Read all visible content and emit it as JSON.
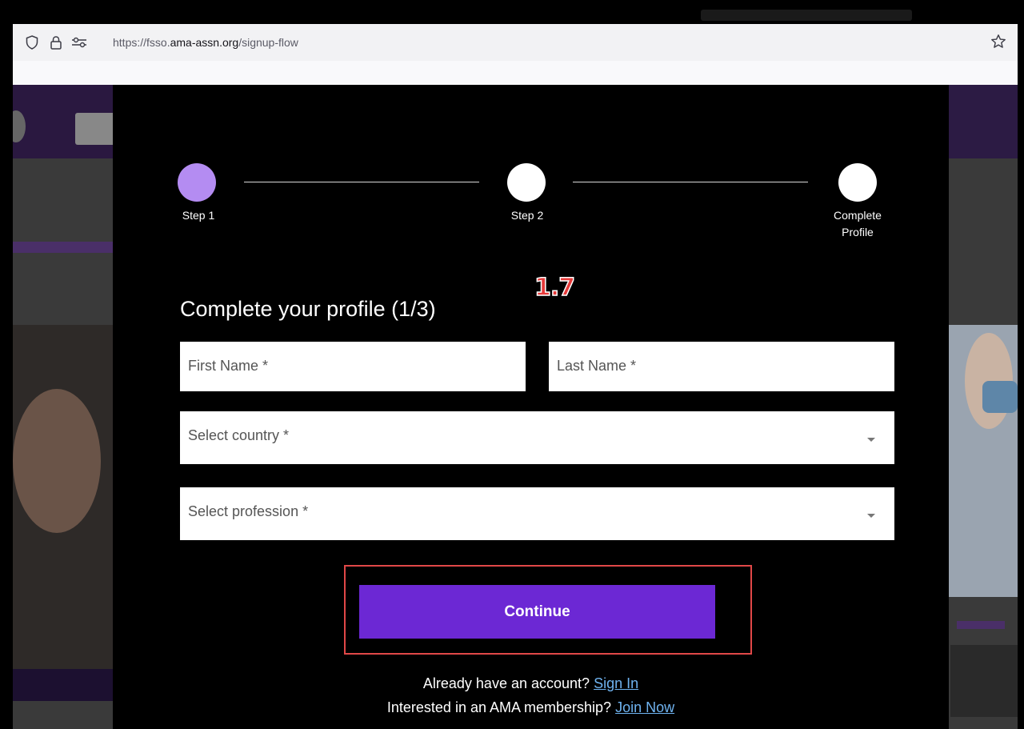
{
  "browser": {
    "url_prefix": "https://fsso.",
    "url_domain": "ama-assn.org",
    "url_path": "/signup-flow",
    "icons": [
      "shield-icon",
      "lock-icon",
      "permissions-icon",
      "bookmark-star-icon"
    ]
  },
  "stepper": {
    "steps": [
      {
        "label": "Step 1",
        "state": "active"
      },
      {
        "label": "Step 2",
        "state": "idle"
      },
      {
        "label_line1": "Complete",
        "label_line2": "Profile",
        "state": "idle"
      }
    ],
    "active_color": "#b48cf2"
  },
  "annotation": "1.7",
  "form": {
    "title": "Complete your profile (1/3)",
    "first_name_placeholder": "First Name *",
    "last_name_placeholder": "Last Name *",
    "country_placeholder": "Select country *",
    "profession_placeholder": "Select profession *",
    "continue_label": "Continue",
    "accent_color": "#6c28d4"
  },
  "footer": {
    "signin_prompt": "Already have an account?",
    "signin_link": "Sign In",
    "membership_prompt": "Interested in an AMA membership?",
    "join_link": "Join Now",
    "link_color": "#6fb3f0"
  }
}
